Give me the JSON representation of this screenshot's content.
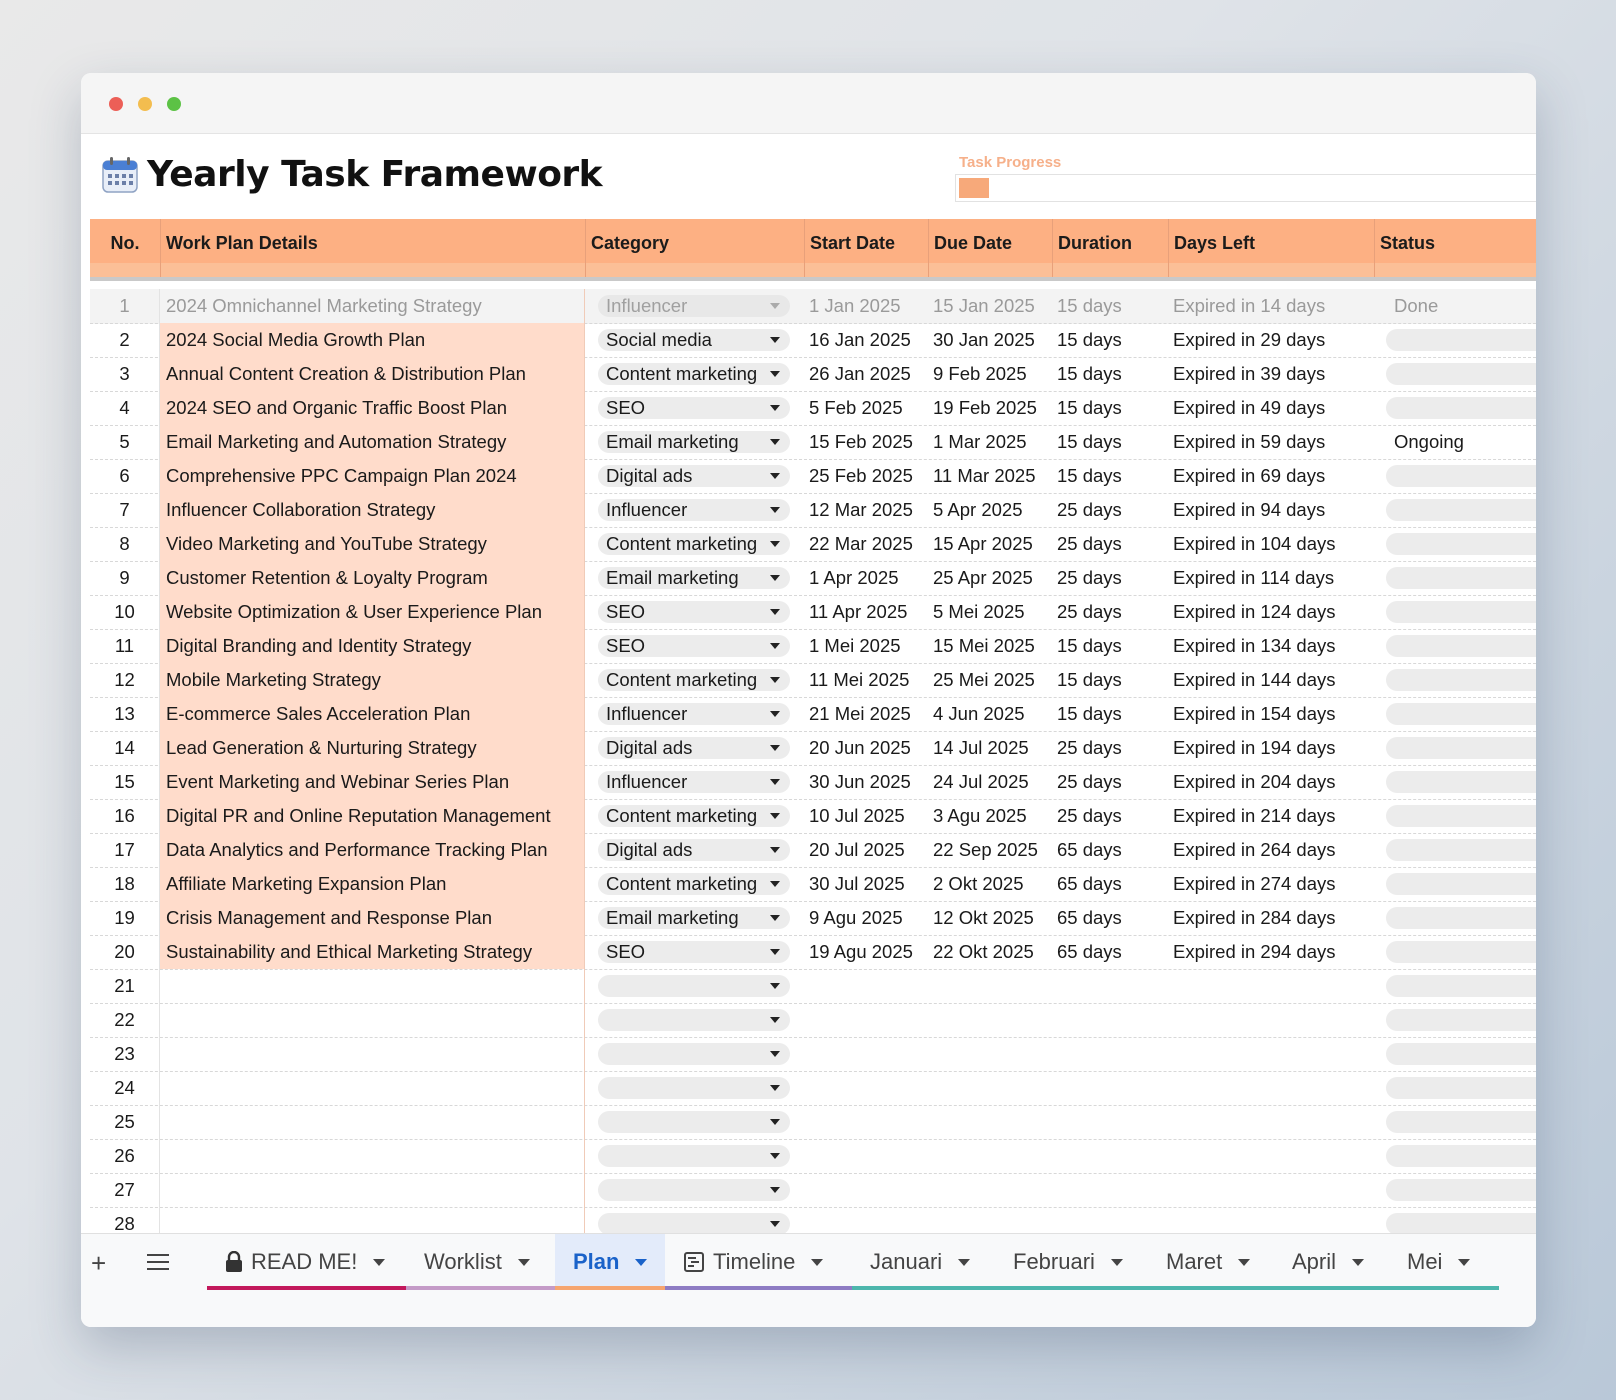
{
  "title": "Yearly Task Framework",
  "progress": {
    "label": "Task Progress",
    "value": 0.05
  },
  "colors": {
    "header": "#fdb083",
    "work_bg": "#ffdccb",
    "accent": "#1a62c9"
  },
  "columns": {
    "no": "No.",
    "work": "Work Plan Details",
    "category": "Category",
    "start": "Start Date",
    "due": "Due Date",
    "duration": "Duration",
    "days_left": "Days Left",
    "status": "Status"
  },
  "rows": [
    {
      "no": "1",
      "work": "2024 Omnichannel Marketing Strategy",
      "category": "Influencer",
      "start": "1 Jan 2025",
      "due": "15 Jan 2025",
      "duration": "15 days",
      "days_left": "Expired in 14 days",
      "status": "Done"
    },
    {
      "no": "2",
      "work": "2024 Social Media Growth Plan",
      "category": "Social media",
      "start": "16 Jan 2025",
      "due": "30 Jan 2025",
      "duration": "15 days",
      "days_left": "Expired in 29 days",
      "status": ""
    },
    {
      "no": "3",
      "work": "Annual Content Creation & Distribution Plan",
      "category": "Content marketing",
      "start": "26 Jan 2025",
      "due": "9 Feb 2025",
      "duration": "15 days",
      "days_left": "Expired in 39 days",
      "status": ""
    },
    {
      "no": "4",
      "work": "2024 SEO and Organic Traffic Boost Plan",
      "category": "SEO",
      "start": "5 Feb 2025",
      "due": "19 Feb 2025",
      "duration": "15 days",
      "days_left": "Expired in 49 days",
      "status": ""
    },
    {
      "no": "5",
      "work": "Email Marketing and Automation Strategy",
      "category": "Email marketing",
      "start": "15 Feb 2025",
      "due": "1 Mar 2025",
      "duration": "15 days",
      "days_left": "Expired in 59 days",
      "status": "Ongoing"
    },
    {
      "no": "6",
      "work": "Comprehensive PPC Campaign Plan 2024",
      "category": "Digital ads",
      "start": "25 Feb 2025",
      "due": "11 Mar 2025",
      "duration": "15 days",
      "days_left": "Expired in 69 days",
      "status": ""
    },
    {
      "no": "7",
      "work": "Influencer Collaboration Strategy",
      "category": "Influencer",
      "start": "12 Mar 2025",
      "due": "5 Apr 2025",
      "duration": "25 days",
      "days_left": "Expired in 94 days",
      "status": ""
    },
    {
      "no": "8",
      "work": "Video Marketing and YouTube Strategy",
      "category": "Content marketing",
      "start": "22 Mar 2025",
      "due": "15 Apr 2025",
      "duration": "25 days",
      "days_left": "Expired in 104 days",
      "status": ""
    },
    {
      "no": "9",
      "work": "Customer Retention & Loyalty Program",
      "category": "Email marketing",
      "start": "1 Apr 2025",
      "due": "25 Apr 2025",
      "duration": "25 days",
      "days_left": "Expired in 114 days",
      "status": ""
    },
    {
      "no": "10",
      "work": "Website Optimization & User Experience Plan",
      "category": "SEO",
      "start": "11 Apr 2025",
      "due": "5 Mei 2025",
      "duration": "25 days",
      "days_left": "Expired in 124 days",
      "status": ""
    },
    {
      "no": "11",
      "work": "Digital Branding and Identity Strategy",
      "category": "SEO",
      "start": "1 Mei 2025",
      "due": "15 Mei 2025",
      "duration": "15 days",
      "days_left": "Expired in 134 days",
      "status": ""
    },
    {
      "no": "12",
      "work": "Mobile Marketing Strategy",
      "category": "Content marketing",
      "start": "11 Mei 2025",
      "due": "25 Mei 2025",
      "duration": "15 days",
      "days_left": "Expired in 144 days",
      "status": ""
    },
    {
      "no": "13",
      "work": "E-commerce Sales Acceleration Plan",
      "category": "Influencer",
      "start": "21 Mei 2025",
      "due": "4 Jun 2025",
      "duration": "15 days",
      "days_left": "Expired in 154 days",
      "status": ""
    },
    {
      "no": "14",
      "work": "Lead Generation & Nurturing Strategy",
      "category": "Digital ads",
      "start": "20 Jun 2025",
      "due": "14 Jul 2025",
      "duration": "25 days",
      "days_left": "Expired in 194 days",
      "status": ""
    },
    {
      "no": "15",
      "work": "Event Marketing and Webinar Series Plan",
      "category": "Influencer",
      "start": "30 Jun 2025",
      "due": "24 Jul 2025",
      "duration": "25 days",
      "days_left": "Expired in 204 days",
      "status": ""
    },
    {
      "no": "16",
      "work": "Digital PR and Online Reputation Management",
      "category": "Content marketing",
      "start": "10 Jul 2025",
      "due": "3 Agu 2025",
      "duration": "25 days",
      "days_left": "Expired in 214 days",
      "status": ""
    },
    {
      "no": "17",
      "work": "Data Analytics and Performance Tracking Plan",
      "category": "Digital ads",
      "start": "20 Jul 2025",
      "due": "22 Sep 2025",
      "duration": "65 days",
      "days_left": "Expired in 264 days",
      "status": ""
    },
    {
      "no": "18",
      "work": "Affiliate Marketing Expansion Plan",
      "category": "Content marketing",
      "start": "30 Jul 2025",
      "due": "2 Okt 2025",
      "duration": "65 days",
      "days_left": "Expired in 274 days",
      "status": ""
    },
    {
      "no": "19",
      "work": "Crisis Management and Response Plan",
      "category": "Email marketing",
      "start": "9 Agu 2025",
      "due": "12 Okt 2025",
      "duration": "65 days",
      "days_left": "Expired in 284 days",
      "status": ""
    },
    {
      "no": "20",
      "work": "Sustainability and Ethical Marketing Strategy",
      "category": "SEO",
      "start": "19 Agu 2025",
      "due": "22 Okt 2025",
      "duration": "65 days",
      "days_left": "Expired in 294 days",
      "status": ""
    },
    {
      "no": "21",
      "work": "",
      "category": "",
      "start": "",
      "due": "",
      "duration": "",
      "days_left": "",
      "status": ""
    },
    {
      "no": "22",
      "work": "",
      "category": "",
      "start": "",
      "due": "",
      "duration": "",
      "days_left": "",
      "status": ""
    },
    {
      "no": "23",
      "work": "",
      "category": "",
      "start": "",
      "due": "",
      "duration": "",
      "days_left": "",
      "status": ""
    },
    {
      "no": "24",
      "work": "",
      "category": "",
      "start": "",
      "due": "",
      "duration": "",
      "days_left": "",
      "status": ""
    },
    {
      "no": "25",
      "work": "",
      "category": "",
      "start": "",
      "due": "",
      "duration": "",
      "days_left": "",
      "status": ""
    },
    {
      "no": "26",
      "work": "",
      "category": "",
      "start": "",
      "due": "",
      "duration": "",
      "days_left": "",
      "status": ""
    },
    {
      "no": "27",
      "work": "",
      "category": "",
      "start": "",
      "due": "",
      "duration": "",
      "days_left": "",
      "status": ""
    },
    {
      "no": "28",
      "work": "",
      "category": "",
      "start": "",
      "due": "",
      "duration": "",
      "days_left": "",
      "status": ""
    }
  ],
  "tabs": [
    {
      "label": "READ ME!",
      "icon": "lock-icon",
      "color": "#c2185b",
      "active": false
    },
    {
      "label": "Worklist",
      "icon": "",
      "color": "#c49bc7",
      "active": false
    },
    {
      "label": "Plan",
      "icon": "",
      "color": "#f6a56f",
      "active": true
    },
    {
      "label": "Timeline",
      "icon": "timeline-icon",
      "color": "#8e7cc3",
      "active": false
    },
    {
      "label": "Januari",
      "icon": "",
      "color": "#4db6ac",
      "active": false
    },
    {
      "label": "Februari",
      "icon": "",
      "color": "#4db6ac",
      "active": false
    },
    {
      "label": "Maret",
      "icon": "",
      "color": "#4db6ac",
      "active": false
    },
    {
      "label": "April",
      "icon": "",
      "color": "#4db6ac",
      "active": false
    },
    {
      "label": "Mei",
      "icon": "",
      "color": "#4db6ac",
      "active": false
    }
  ]
}
